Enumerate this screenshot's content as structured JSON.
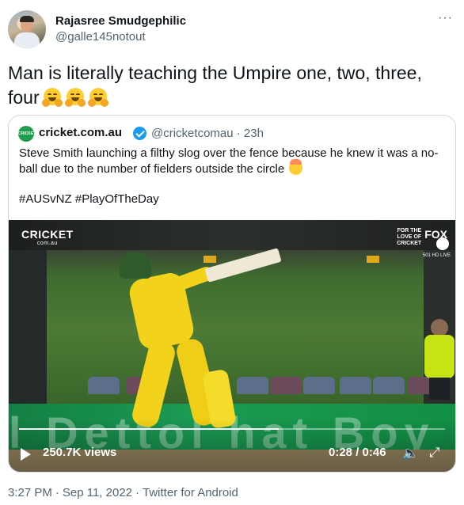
{
  "tweet": {
    "display_name": "Rajasree Smudgephilic",
    "handle": "@galle145notout",
    "more_label": "···",
    "text": "Man is literally teaching the Umpire one, two, three, four",
    "emoji_name": "hugging-face-icon",
    "meta": {
      "time": "3:27 PM",
      "separator": "·",
      "date": "Sep 11, 2022",
      "source": "Twitter for Android"
    }
  },
  "quote": {
    "account_logo_text": "CRICKET",
    "name": "cricket.com.au",
    "verified_icon": "verified-badge-icon",
    "handle_time": "@cricketcomau · 23h",
    "text": "Steve Smith launching a filthy slog over the fence because he knew it was a no-ball due to the number of fielders outside the circle",
    "text_emoji": "exploding-head-icon",
    "hashtags": "#AUSvNZ #PlayOfTheDay"
  },
  "video": {
    "overlay_left_logo": "CRICKET",
    "overlay_left_sub": "com.au",
    "overlay_right_small": "FOR THE LOVE OF CRICKET",
    "overlay_right_brand": "FOX",
    "overlay_right_sub": "501 HD LIVE",
    "board_text": "l  Dettol   hat   Boy",
    "views": "250.7K views",
    "time": "0:28 / 0:46",
    "progress": 0.61,
    "play_icon": "play-icon",
    "volume_icon": "volume-icon",
    "fullscreen_icon": "fullscreen-icon"
  },
  "colors": {
    "text": "#0f1419",
    "secondary": "#536471",
    "border": "#cfd9de",
    "verified": "#1d9bf0",
    "cricket_green": "#1f9c4d"
  }
}
